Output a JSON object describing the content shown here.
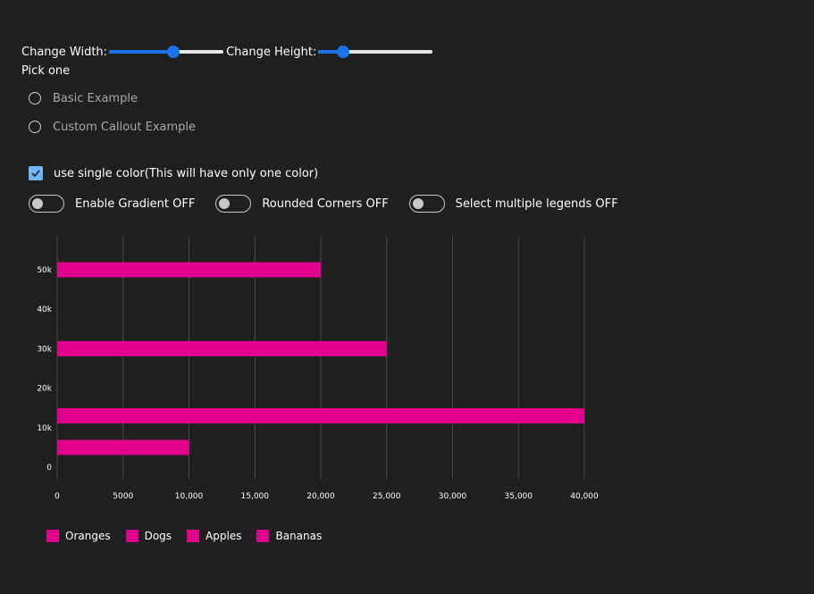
{
  "controls": {
    "width_label": "Change Width:",
    "width_value": 0.56,
    "height_label": "Change Height:",
    "height_value": 0.22,
    "pick_label": "Pick one",
    "radios": [
      "Basic Example",
      "Custom Callout Example"
    ],
    "checkbox_label": "use single color(This will have only one color)",
    "checkbox_checked": true,
    "toggles": [
      "Enable Gradient OFF",
      "Rounded Corners OFF",
      "Select multiple legends OFF"
    ]
  },
  "chart_data": {
    "type": "bar",
    "orientation": "horizontal",
    "bar_color": "#e3008c",
    "xlim": [
      0,
      40000
    ],
    "x_ticks": [
      "0",
      "5000",
      "10,000",
      "15,000",
      "20,000",
      "25,000",
      "30,000",
      "35,000",
      "40,000"
    ],
    "ylim": [
      0,
      50000
    ],
    "y_ticks": [
      "0",
      "10k",
      "20k",
      "30k",
      "40k",
      "50k"
    ],
    "bars": [
      {
        "y": 50000,
        "x": 20000
      },
      {
        "y": 30000,
        "x": 25000
      },
      {
        "y": 13000,
        "x": 40000
      },
      {
        "y": 5000,
        "x": 10000
      }
    ],
    "grid": true,
    "legend": {
      "placement": "bottom-left",
      "items": [
        {
          "label": "Oranges",
          "color": "#e3008c"
        },
        {
          "label": "Dogs",
          "color": "#e3008c"
        },
        {
          "label": "Apples",
          "color": "#e3008c"
        },
        {
          "label": "Bananas",
          "color": "#e3008c"
        }
      ]
    }
  }
}
